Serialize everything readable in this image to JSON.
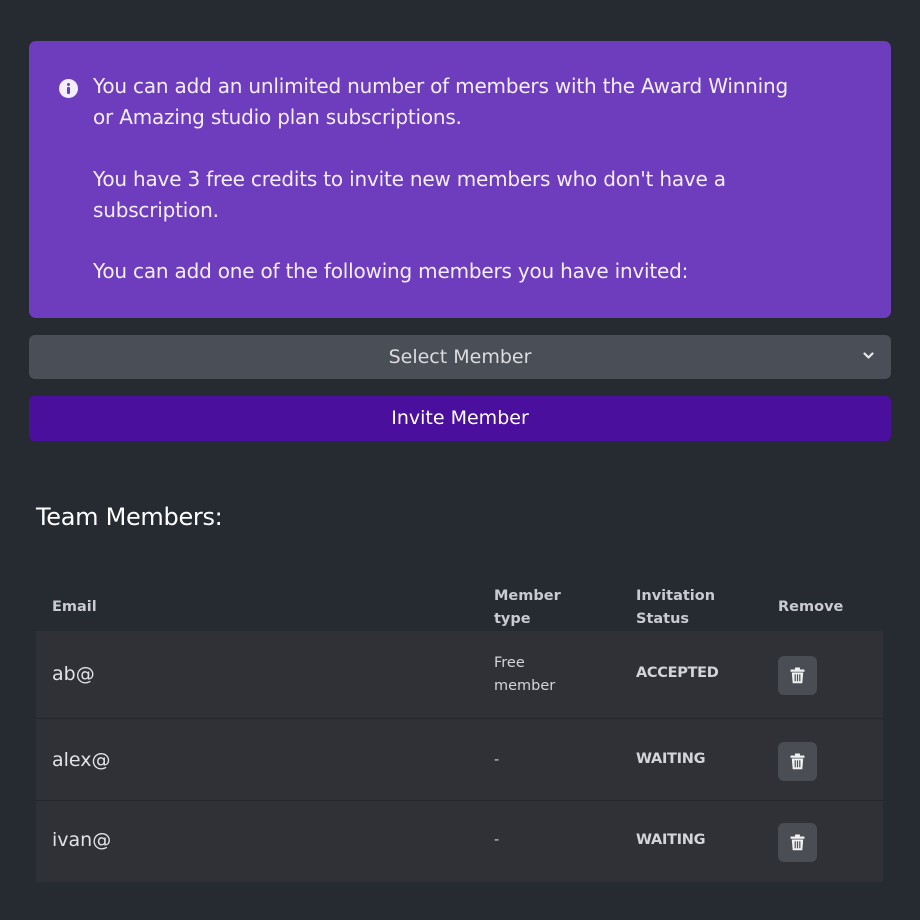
{
  "info": {
    "line1": "You can add an unlimited number of members with the Award Winning",
    "line2": "or Amazing studio plan subscriptions.",
    "line3": "You have 3 free credits to invite new members who don't have a",
    "line4": "subscription.",
    "line5": "You can add one of the following members you have invited:",
    "icon": "info-circle-icon"
  },
  "select": {
    "label": "Select Member",
    "icon": "chevron-down-icon"
  },
  "invite_button": {
    "label": "Invite Member"
  },
  "team": {
    "title": "Team Members:",
    "headers": {
      "email": "Email",
      "type_line1": "Member",
      "type_line2": "type",
      "status_line1": "Invitation",
      "status_line2": "Status",
      "remove": "Remove"
    },
    "rows": [
      {
        "email": "ab@",
        "type_line1": "Free",
        "type_line2": "member",
        "status": "ACCEPTED"
      },
      {
        "email": "alex@",
        "type_line1": "-",
        "type_line2": "",
        "status": "WAITING"
      },
      {
        "email": "ivan@",
        "type_line1": "-",
        "type_line2": "",
        "status": "WAITING"
      }
    ],
    "remove_icon": "trash-icon"
  },
  "colors": {
    "background": "#262a31",
    "info_panel": "#6e3dbd",
    "select_bg": "#4a4e56",
    "invite_button": "#4a0f9c",
    "table_row": "#2f3136"
  }
}
